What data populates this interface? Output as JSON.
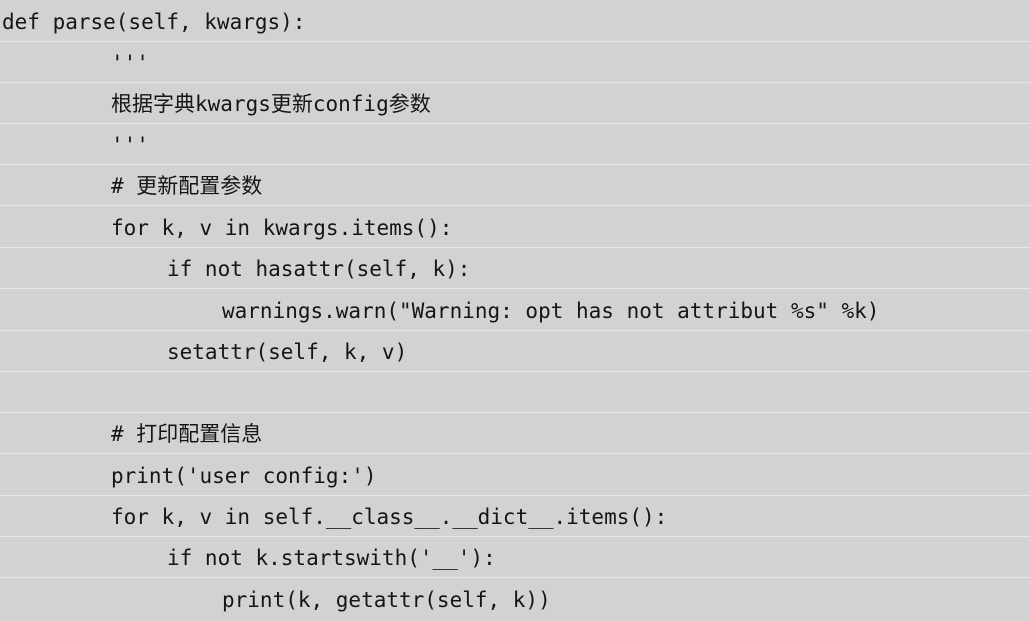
{
  "code": {
    "lines": [
      {
        "indent": 0,
        "text": "def parse(self, kwargs):"
      },
      {
        "indent": 1,
        "text": "'''"
      },
      {
        "indent": 1,
        "text": "根据字典kwargs更新config参数"
      },
      {
        "indent": 1,
        "text": "'''"
      },
      {
        "indent": 1,
        "text": "# 更新配置参数"
      },
      {
        "indent": 1,
        "text": "for k, v in kwargs.items():"
      },
      {
        "indent": 2,
        "text": "if not hasattr(self, k):"
      },
      {
        "indent": 3,
        "text": "warnings.warn(\"Warning: opt has not attribut %s\" %k)"
      },
      {
        "indent": 2,
        "text": "setattr(self, k, v)"
      },
      {
        "indent": 1,
        "text": ""
      },
      {
        "indent": 1,
        "text": "# 打印配置信息"
      },
      {
        "indent": 1,
        "text": "print('user config:')"
      },
      {
        "indent": 1,
        "text": "for k, v in self.__class__.__dict__.items():"
      },
      {
        "indent": 2,
        "text": "if not k.startswith('__'):"
      },
      {
        "indent": 3,
        "text": "print(k, getattr(self, k))"
      }
    ]
  }
}
